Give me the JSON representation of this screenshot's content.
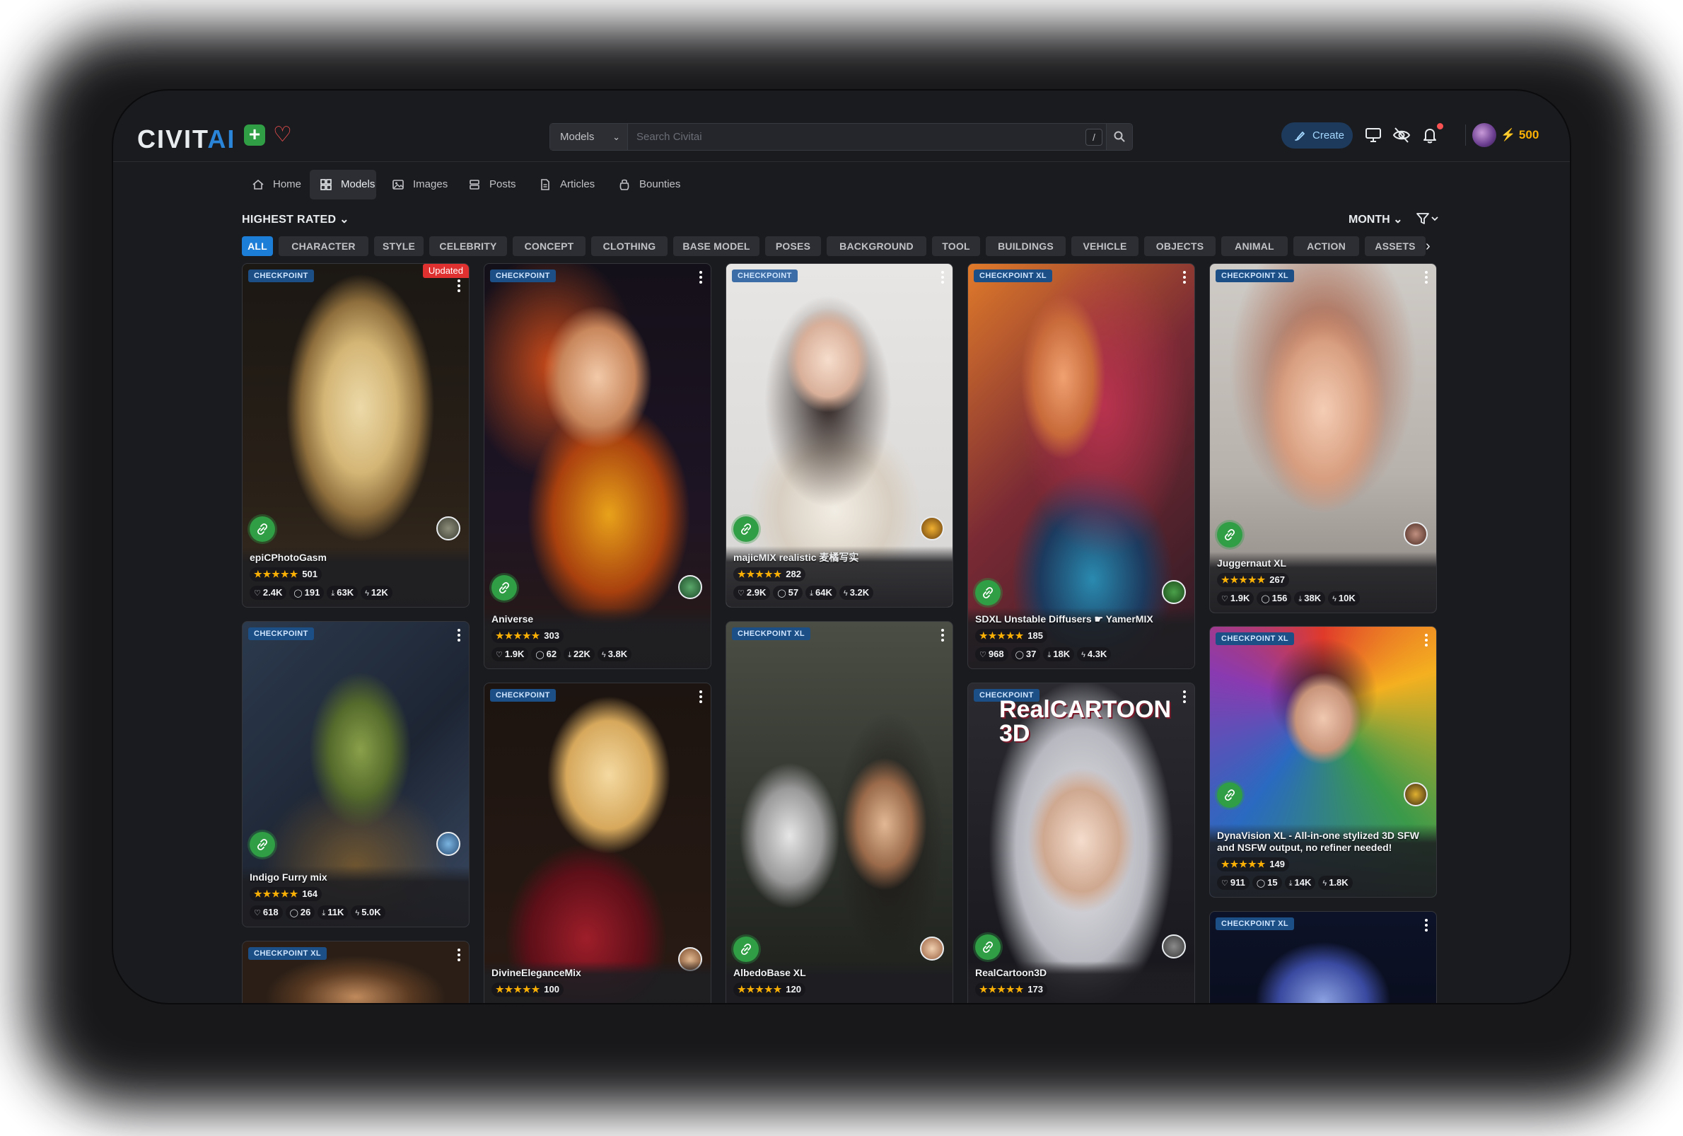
{
  "brand": {
    "logo_main": "CIVIT",
    "logo_ai": "AI"
  },
  "search": {
    "type_label": "Models",
    "placeholder": "Search Civitai",
    "shortcut": "/"
  },
  "header": {
    "create_label": "Create",
    "buzz_amount": "500"
  },
  "nav": {
    "items": [
      {
        "label": "Home",
        "icon": "home-icon"
      },
      {
        "label": "Models",
        "icon": "grid-icon"
      },
      {
        "label": "Images",
        "icon": "image-icon"
      },
      {
        "label": "Posts",
        "icon": "posts-icon"
      },
      {
        "label": "Articles",
        "icon": "article-icon"
      },
      {
        "label": "Bounties",
        "icon": "bounty-icon"
      }
    ]
  },
  "controls": {
    "sort_label": "HIGHEST RATED",
    "period_label": "MONTH"
  },
  "chips": [
    "ALL",
    "CHARACTER",
    "STYLE",
    "CELEBRITY",
    "CONCEPT",
    "CLOTHING",
    "BASE MODEL",
    "POSES",
    "BACKGROUND",
    "TOOL",
    "BUILDINGS",
    "VEHICLE",
    "OBJECTS",
    "ANIMAL",
    "ACTION",
    "ASSETS"
  ],
  "colors": {
    "accent": "#1c7ed6",
    "success": "#2f9e44",
    "danger": "#e03131",
    "star": "#fab005",
    "background": "#1a1b1e"
  },
  "cards": [
    {
      "badge": "CHECKPOINT",
      "updated": "Updated",
      "title": "epiCPhotoGasm",
      "rating": "501",
      "likes": "2.4K",
      "comments": "191",
      "downloads": "63K",
      "buzz": "12K"
    },
    {
      "badge": "CHECKPOINT",
      "title": "Indigo Furry mix",
      "rating": "164",
      "likes": "618",
      "comments": "26",
      "downloads": "11K",
      "buzz": "5.0K"
    },
    {
      "badge": "CHECKPOINT XL"
    },
    {
      "badge": "CHECKPOINT",
      "title": "Aniverse",
      "rating": "303",
      "likes": "1.9K",
      "comments": "62",
      "downloads": "22K",
      "buzz": "3.8K"
    },
    {
      "badge": "CHECKPOINT",
      "title": "DivineEleganceMix",
      "rating": "100"
    },
    {
      "badge": "CHECKPOINT",
      "title": "majicMIX realistic 麦橘写实",
      "rating": "282",
      "likes": "2.9K",
      "comments": "57",
      "downloads": "64K",
      "buzz": "3.2K"
    },
    {
      "badge": "CHECKPOINT XL",
      "title": "AlbedoBase XL",
      "rating": "120"
    },
    {
      "badge": "CHECKPOINT XL",
      "title": "SDXL Unstable Diffusers ☛ YamerMIX",
      "rating": "185",
      "likes": "968",
      "comments": "37",
      "downloads": "18K",
      "buzz": "4.3K"
    },
    {
      "badge": "CHECKPOINT",
      "title": "RealCartoon3D",
      "rating": "173",
      "art_text": "RealCARTOON 3D"
    },
    {
      "badge": "CHECKPOINT XL",
      "title": "Juggernaut XL",
      "rating": "267",
      "likes": "1.9K",
      "comments": "156",
      "downloads": "38K",
      "buzz": "10K"
    },
    {
      "badge": "CHECKPOINT XL",
      "title": "DynaVision XL - All-in-one stylized 3D SFW and NSFW output, no refiner needed!",
      "rating": "149",
      "likes": "911",
      "comments": "15",
      "downloads": "14K",
      "buzz": "1.8K"
    },
    {
      "badge": "CHECKPOINT XL"
    }
  ]
}
